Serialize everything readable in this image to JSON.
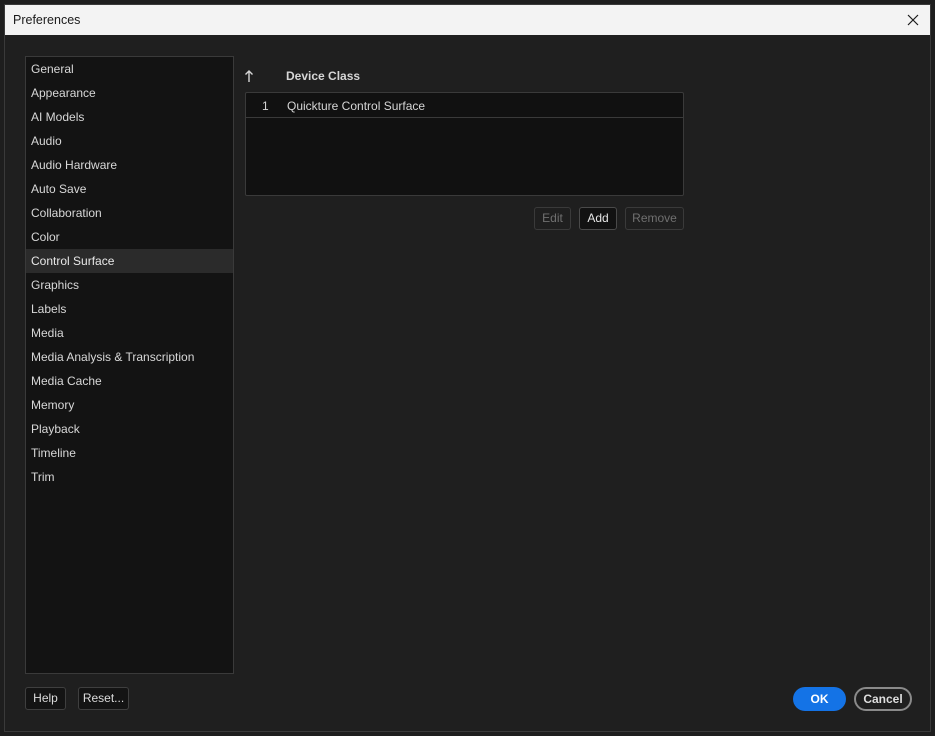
{
  "window": {
    "title": "Preferences"
  },
  "sidebar": {
    "items": [
      {
        "label": "General"
      },
      {
        "label": "Appearance"
      },
      {
        "label": "AI Models"
      },
      {
        "label": "Audio"
      },
      {
        "label": "Audio Hardware"
      },
      {
        "label": "Auto Save"
      },
      {
        "label": "Collaboration"
      },
      {
        "label": "Color"
      },
      {
        "label": "Control Surface",
        "selected": true
      },
      {
        "label": "Graphics"
      },
      {
        "label": "Labels"
      },
      {
        "label": "Media"
      },
      {
        "label": "Media Analysis & Transcription"
      },
      {
        "label": "Media Cache"
      },
      {
        "label": "Memory"
      },
      {
        "label": "Playback"
      },
      {
        "label": "Timeline"
      },
      {
        "label": "Trim"
      }
    ]
  },
  "table": {
    "column_header": "Device Class",
    "sort_icon": "sort-ascending-icon",
    "rows": [
      {
        "index": "1",
        "device_class": "Quickture Control Surface"
      }
    ]
  },
  "table_buttons": {
    "edit": "Edit",
    "add": "Add",
    "remove": "Remove"
  },
  "footer": {
    "help": "Help",
    "reset": "Reset...",
    "ok": "OK",
    "cancel": "Cancel"
  },
  "colors": {
    "accent": "#1473e6",
    "background": "#1f1f1f",
    "selected_row": "#2b2b2b"
  }
}
